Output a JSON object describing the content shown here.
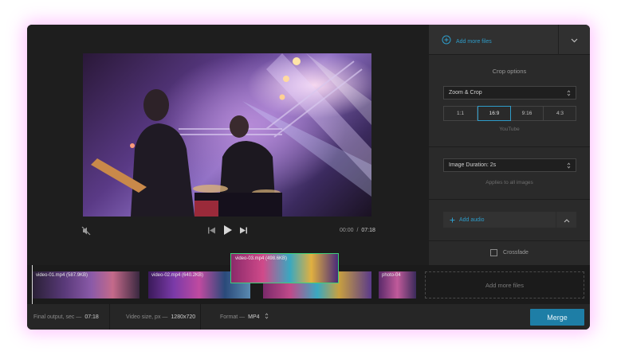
{
  "sidebar": {
    "add_files_label": "Add more files",
    "crop_title": "Crop options",
    "crop_mode": "Zoom & Crop",
    "ratios": [
      "1:1",
      "16:9",
      "9:16",
      "4:3"
    ],
    "selected_ratio": "16:9",
    "ratio_hint": "YouTube",
    "image_duration": "Image Duration: 2s",
    "image_duration_hint": "Applies to all images",
    "add_audio_label": "Add audio",
    "crossfade_label": "Crossfade"
  },
  "player": {
    "current_time": "00:00",
    "separator": "/",
    "total_time": "07:18"
  },
  "timeline": {
    "clips": [
      {
        "label": "video-01.mp4 (587.9KB)"
      },
      {
        "label": "video-02.mp4 (640.2KB)"
      },
      {
        "label": "video-03.mp4 (498.6KB)"
      },
      {
        "label": "photo-04"
      }
    ],
    "add_files_label": "Add more files"
  },
  "footer": {
    "final_output_label": "Final output, sec —",
    "final_output_value": "07:18",
    "video_size_label": "Video size, px —",
    "video_size_value": "1280x720",
    "format_label": "Format —",
    "format_value": "MP4",
    "merge_label": "Merge"
  },
  "colors": {
    "accent": "#2e9cc9",
    "merge_button": "#1e7ea6",
    "selection_border": "#3ecf7a",
    "glow": "#ff78ff"
  }
}
